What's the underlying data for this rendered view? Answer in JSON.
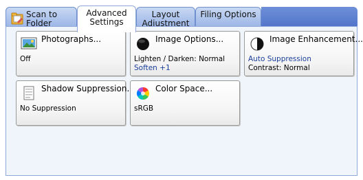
{
  "tabs": [
    {
      "label_line1": "Scan to",
      "label_line2": "Folder"
    },
    {
      "label_line1": "Advanced",
      "label_line2": "Settings"
    },
    {
      "label_line1": "Layout",
      "label_line2": "Adjustment"
    },
    {
      "label_line1": "Filing Options",
      "label_line2": ""
    }
  ],
  "cards": {
    "photographs": {
      "title": "Photographs...",
      "line1": "Off",
      "line2": ""
    },
    "image_options": {
      "title": "Image Options...",
      "line1": "Lighten / Darken: Normal",
      "line2": "Soften +1"
    },
    "image_enhancement": {
      "title": "Image Enhancement...",
      "line1": "Auto Suppression",
      "line2": "Contrast: Normal"
    },
    "shadow_suppression": {
      "title": "Shadow Suppression...",
      "line1": "No Suppression",
      "line2": ""
    },
    "color_space": {
      "title": "Color Space...",
      "line1": "sRGB",
      "line2": ""
    }
  },
  "colors": {
    "tab_blue": "#a9c0ea",
    "value_blue": "#1a3f9a",
    "panel_bg": "#f0f5fb"
  },
  "icons": [
    "folder-icon",
    "photograph-icon",
    "black-circle-icon",
    "half-circle-icon",
    "document-icon",
    "color-wheel-icon"
  ]
}
